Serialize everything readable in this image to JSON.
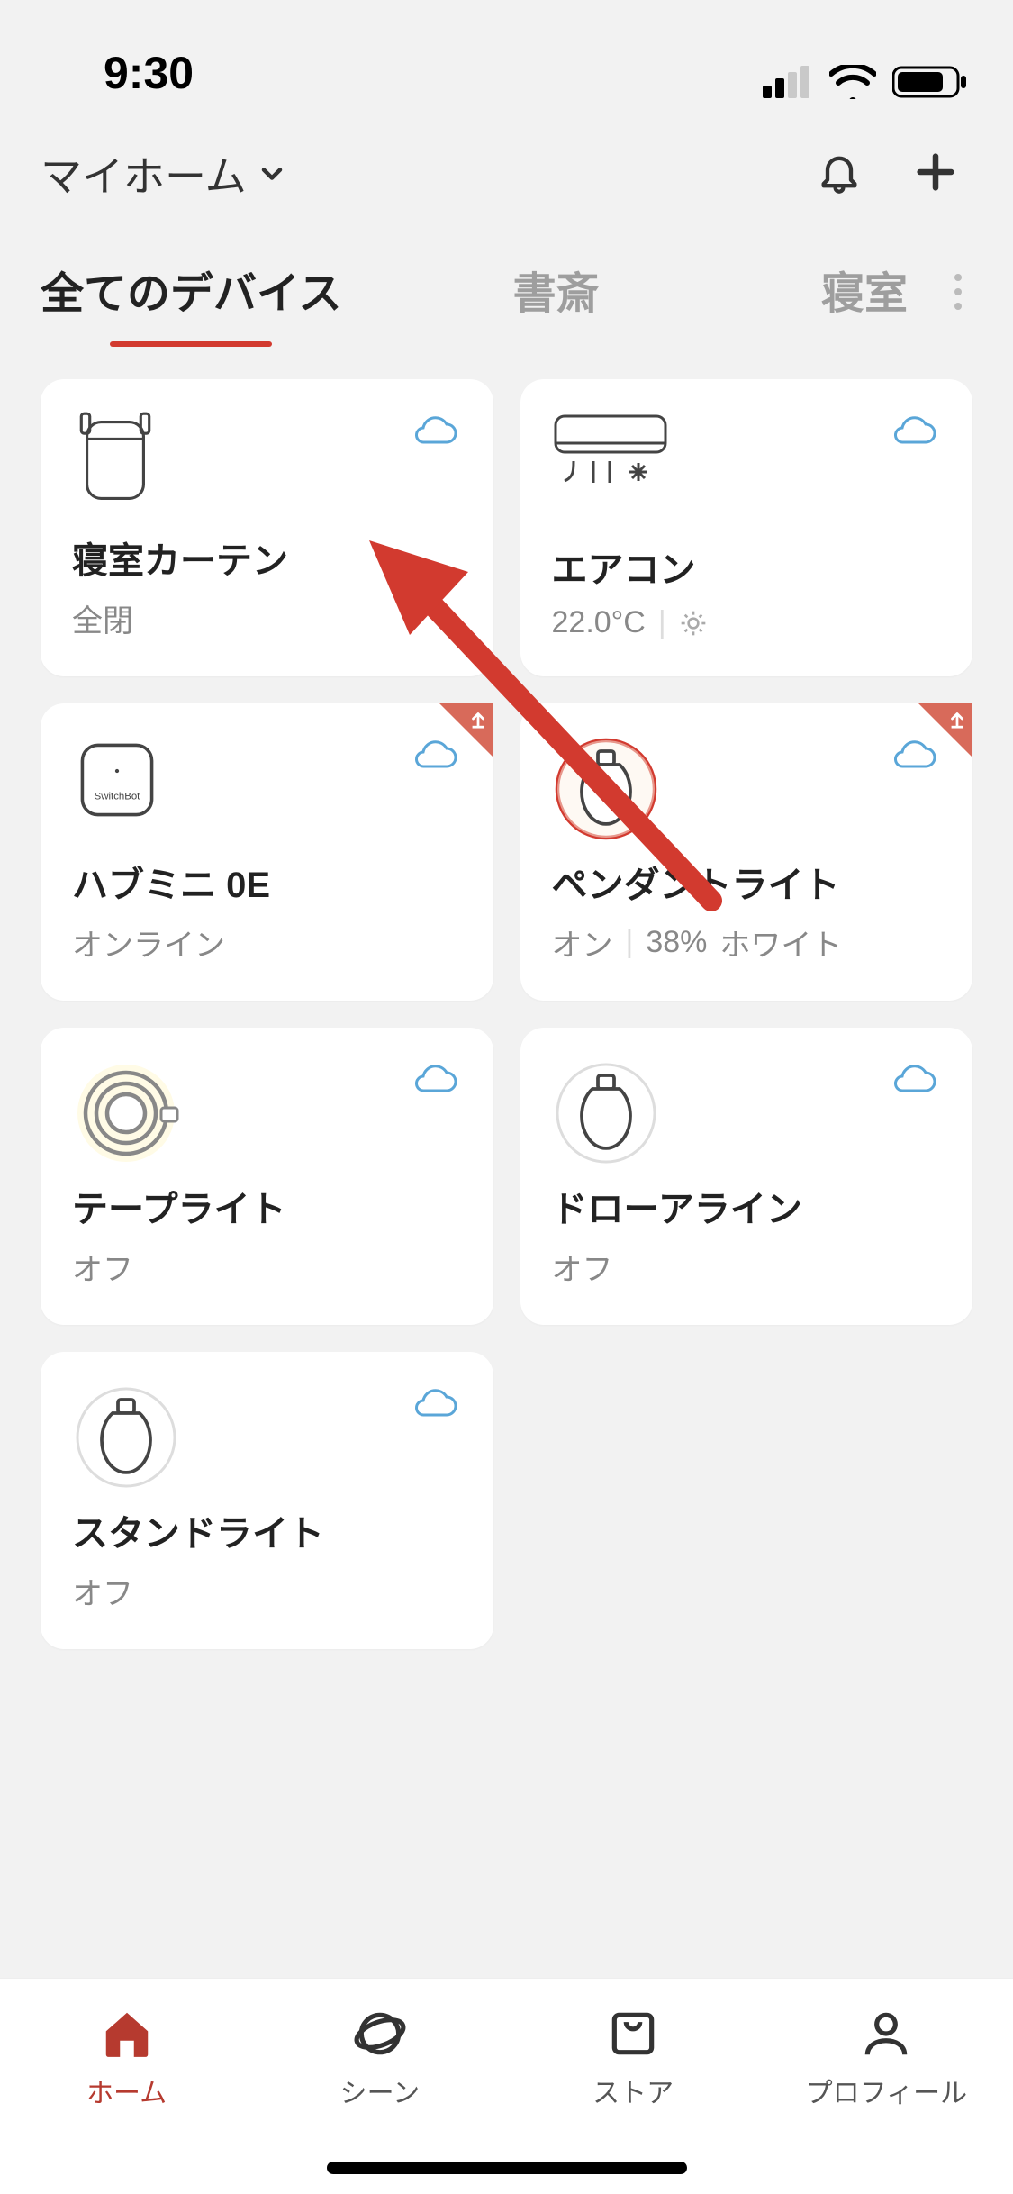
{
  "status": {
    "time": "9:30"
  },
  "header": {
    "home_label": "マイホーム"
  },
  "tabs": {
    "all_devices": "全てのデバイス",
    "study": "書斎",
    "bedroom": "寝室"
  },
  "devices": [
    {
      "name": "寝室カーテン",
      "status": "全閉"
    },
    {
      "name": "エアコン",
      "status": "22.0°C"
    },
    {
      "name": "ハブミニ 0E",
      "status": "オンライン"
    },
    {
      "name": "ペンダントライト",
      "status_on": "オン",
      "status_pct": "38%",
      "status_color": "ホワイト"
    },
    {
      "name": "テープライト",
      "status": "オフ"
    },
    {
      "name": "ドローアライン",
      "status": "オフ"
    },
    {
      "name": "スタンドライト",
      "status": "オフ"
    }
  ],
  "tabbar": {
    "home": "ホーム",
    "scene": "シーン",
    "store": "ストア",
    "profile": "プロフィール"
  }
}
